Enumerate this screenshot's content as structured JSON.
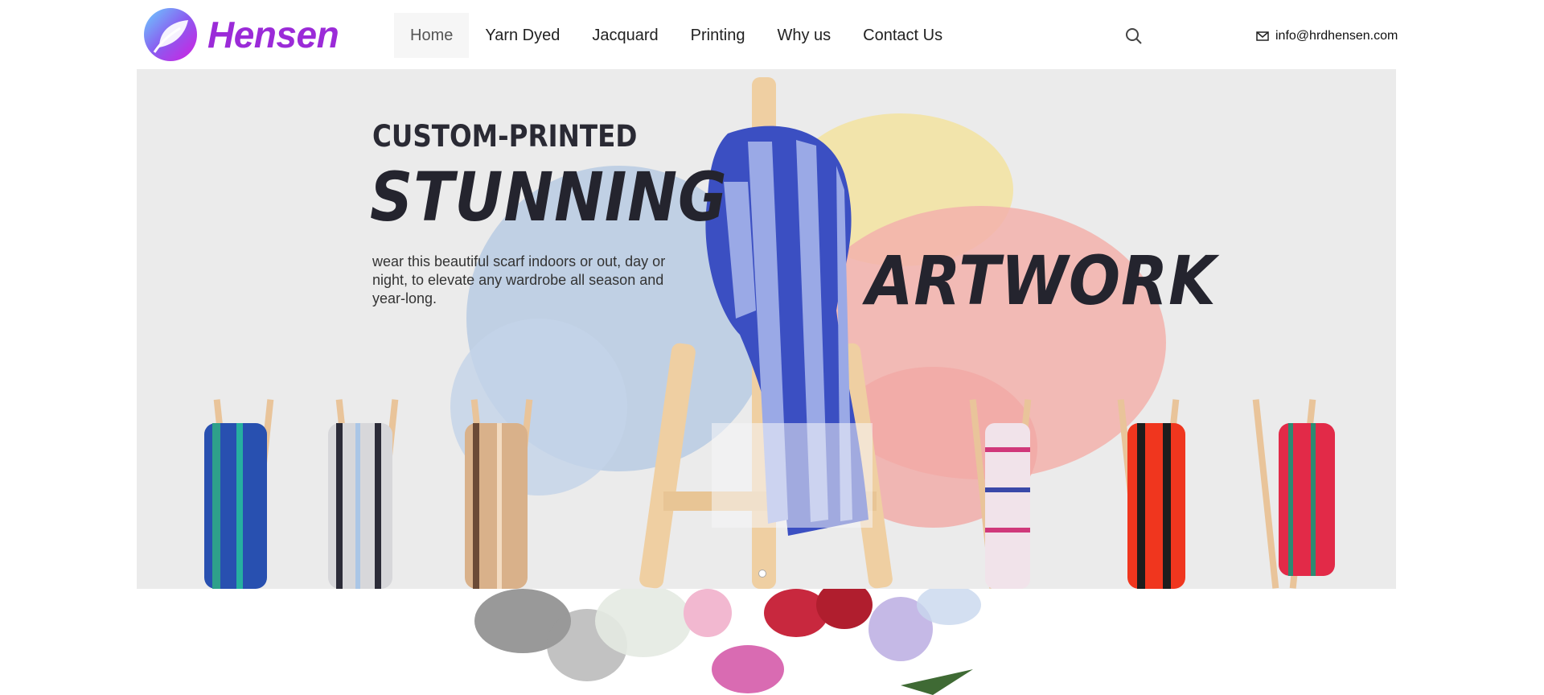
{
  "brand": {
    "name": "Hensen",
    "color": "#9b2bd8"
  },
  "nav": {
    "items": [
      {
        "label": "Home",
        "active": true
      },
      {
        "label": "Yarn Dyed",
        "active": false
      },
      {
        "label": "Jacquard",
        "active": false
      },
      {
        "label": "Printing",
        "active": false
      },
      {
        "label": "Why us",
        "active": false
      },
      {
        "label": "Contact Us",
        "active": false
      }
    ]
  },
  "header": {
    "search_icon": "search-icon",
    "email": "info@hrdhensen.com",
    "email_icon": "mail-icon"
  },
  "hero": {
    "subtitle": "CUSTOM-PRINTED",
    "title_left": "STUNNING",
    "title_right": "ARTWORK",
    "description": "wear this beautiful scarf indoors or out, day or night, to elevate any wardrobe all season and year-long.",
    "slide_indicator": "1"
  }
}
